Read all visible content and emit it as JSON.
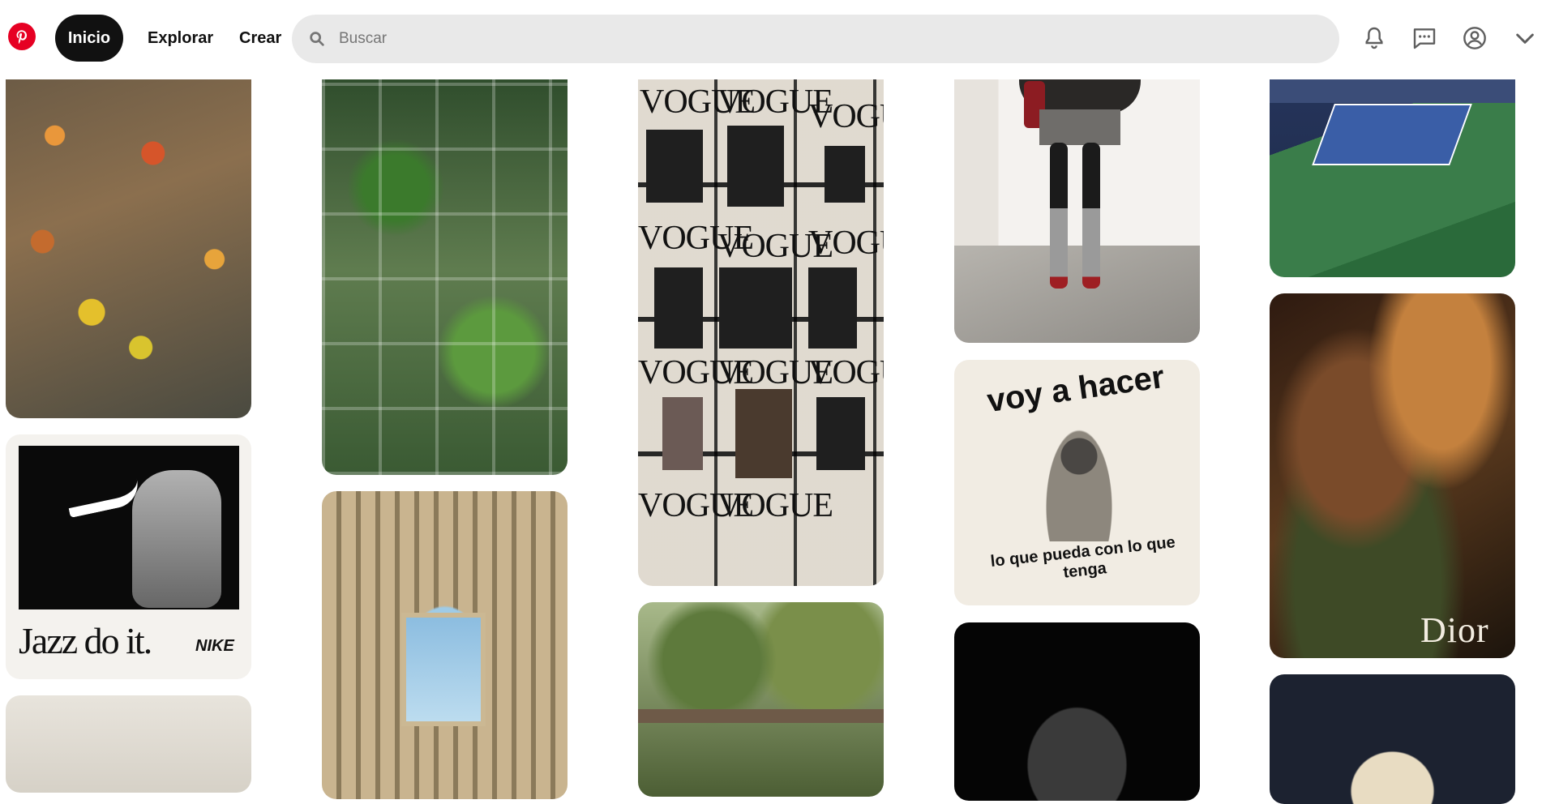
{
  "header": {
    "logo_icon": "pinterest-logo-icon",
    "nav": {
      "home_label": "Inicio",
      "explore_label": "Explorar",
      "create_label": "Crear"
    },
    "search": {
      "placeholder": "Buscar",
      "icon": "search-icon"
    },
    "actions": [
      "bell-icon",
      "message-icon",
      "profile-icon",
      "chevron-down-icon"
    ]
  },
  "pins": {
    "jazz": {
      "headline": "Jazz do it.",
      "brand": "NIKE"
    },
    "voy": {
      "top_text": "voy a hacer",
      "bottom_text": "lo que pueda con lo que tenga"
    },
    "dior": {
      "brand": "Dior"
    },
    "vogue": {
      "masthead": "VOGUE"
    }
  },
  "colors": {
    "brand_red": "#e60023",
    "active_pill": "#111111",
    "search_bg": "#e9e9e9"
  }
}
